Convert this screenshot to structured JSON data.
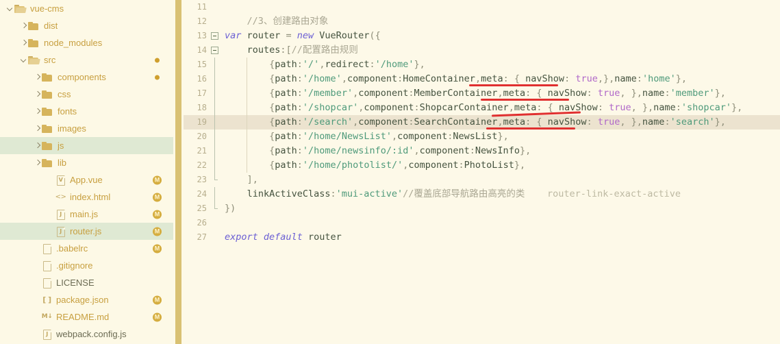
{
  "sidebar": {
    "name": "project-file-tree",
    "items": [
      {
        "label": "vue-cms",
        "type": "folder",
        "state": "open",
        "depth": 0,
        "badge": null,
        "dot": false,
        "selected": false
      },
      {
        "label": "dist",
        "type": "folder",
        "state": "closed",
        "depth": 1,
        "badge": null,
        "dot": false,
        "selected": false
      },
      {
        "label": "node_modules",
        "type": "folder",
        "state": "closed",
        "depth": 1,
        "badge": null,
        "dot": false,
        "selected": false
      },
      {
        "label": "src",
        "type": "folder",
        "state": "open",
        "depth": 1,
        "badge": null,
        "dot": true,
        "selected": false
      },
      {
        "label": "components",
        "type": "folder",
        "state": "closed",
        "depth": 2,
        "badge": null,
        "dot": true,
        "selected": false
      },
      {
        "label": "css",
        "type": "folder",
        "state": "closed",
        "depth": 2,
        "badge": null,
        "dot": false,
        "selected": false
      },
      {
        "label": "fonts",
        "type": "folder",
        "state": "closed",
        "depth": 2,
        "badge": null,
        "dot": false,
        "selected": false
      },
      {
        "label": "images",
        "type": "folder",
        "state": "closed",
        "depth": 2,
        "badge": null,
        "dot": false,
        "selected": false
      },
      {
        "label": "js",
        "type": "folder",
        "state": "closed",
        "depth": 2,
        "badge": null,
        "dot": false,
        "selected": true
      },
      {
        "label": "lib",
        "type": "folder",
        "state": "closed",
        "depth": 2,
        "badge": null,
        "dot": false,
        "selected": false
      },
      {
        "label": "App.vue",
        "type": "file",
        "icon": "vue-file-icon",
        "glyph": "V",
        "depth": 3,
        "badge": "M",
        "dot": false,
        "selected": false
      },
      {
        "label": "index.html",
        "type": "file",
        "icon": "html-file-icon",
        "glyph": "<>",
        "depth": 3,
        "badge": "M",
        "dot": false,
        "selected": false
      },
      {
        "label": "main.js",
        "type": "file",
        "icon": "js-file-icon",
        "glyph": "J",
        "depth": 3,
        "badge": "M",
        "dot": false,
        "selected": false
      },
      {
        "label": "router.js",
        "type": "file",
        "icon": "js-file-icon",
        "glyph": "J",
        "depth": 3,
        "badge": "M",
        "dot": false,
        "selected": true
      },
      {
        "label": ".babelrc",
        "type": "file",
        "icon": "plain-file-icon",
        "glyph": "",
        "depth": 2,
        "badge": "M",
        "dot": false,
        "selected": false
      },
      {
        "label": ".gitignore",
        "type": "file",
        "icon": "plain-file-icon",
        "glyph": "",
        "depth": 2,
        "badge": null,
        "dot": false,
        "selected": false
      },
      {
        "label": "LICENSE",
        "type": "file",
        "icon": "plain-file-icon",
        "glyph": "",
        "depth": 2,
        "badge": null,
        "dot": false,
        "selected": false,
        "plain": true
      },
      {
        "label": "package.json",
        "type": "file",
        "icon": "json-file-icon",
        "glyph": "[ ]",
        "depth": 2,
        "badge": "M",
        "dot": false,
        "selected": false
      },
      {
        "label": "README.md",
        "type": "file",
        "icon": "markdown-file-icon",
        "glyph": "M↓",
        "depth": 2,
        "badge": "M",
        "dot": false,
        "selected": false
      },
      {
        "label": "webpack.config.js",
        "type": "file",
        "icon": "js-file-icon",
        "glyph": "J",
        "depth": 2,
        "badge": null,
        "dot": false,
        "selected": false,
        "plain": true
      }
    ]
  },
  "editor": {
    "name": "code-editor",
    "current_line": 19,
    "lines": [
      {
        "n": "11",
        "fold": null,
        "text": ""
      },
      {
        "n": "12",
        "fold": null,
        "text": "    //3、创建路由对象"
      },
      {
        "n": "13",
        "fold": "open",
        "text": "var router = new VueRouter({"
      },
      {
        "n": "14",
        "fold": "open",
        "text": "    routes:[//配置路由规则"
      },
      {
        "n": "15",
        "fold": null,
        "text": "        {path:'/',redirect:'/home'},"
      },
      {
        "n": "16",
        "fold": null,
        "text": "        {path:'/home',component:HomeContainer,meta: { navShow: true,},name:'home'},"
      },
      {
        "n": "17",
        "fold": null,
        "text": "        {path:'/member',component:MemberContainer,meta: { navShow: true, },name:'member'},"
      },
      {
        "n": "18",
        "fold": null,
        "text": "        {path:'/shopcar',component:ShopcarContainer,meta: { navShow: true, },name:'shopcar'},"
      },
      {
        "n": "19",
        "fold": null,
        "text": "        {path:'/search',component:SearchContainer,meta: { navShow: true, },name:'search'},"
      },
      {
        "n": "20",
        "fold": null,
        "text": "        {path:'/home/NewsList',component:NewsList},"
      },
      {
        "n": "21",
        "fold": null,
        "text": "        {path:'/home/newsinfo/:id',component:NewsInfo},"
      },
      {
        "n": "22",
        "fold": null,
        "text": "        {path:'/home/photolist/',component:PhotoList},"
      },
      {
        "n": "23",
        "fold": "endline",
        "text": "    ],"
      },
      {
        "n": "24",
        "fold": null,
        "text": "    linkActiveClass:'mui-active'//覆盖底部导航路由高亮的类    router-link-exact-active"
      },
      {
        "n": "25",
        "fold": "endfold",
        "text": "})"
      },
      {
        "n": "26",
        "fold": null,
        "text": ""
      },
      {
        "n": "27",
        "fold": null,
        "text": "export default router"
      }
    ],
    "annotations": {
      "name": "red-underline-annotations",
      "count": 4,
      "color": "#e03030",
      "targets": [
        "meta: { navShow: true,}",
        "meta: { navShow: true, }",
        "meta: { navShow: true, }",
        "meta: { navShow: true, }"
      ]
    }
  },
  "colors": {
    "sidebar_bg": "#fdf9e6",
    "editor_bg": "#fdf9e8",
    "selection_bg": "#dfe9d3",
    "current_line_bg": "#ece3cf",
    "scrollbar": "#d9c173",
    "accent_gold": "#c79f3f",
    "annotation_red": "#e03030",
    "string_green": "#4e9a7a",
    "keyword_purple": "#6b5fd4",
    "bool_magenta": "#b068c9"
  }
}
